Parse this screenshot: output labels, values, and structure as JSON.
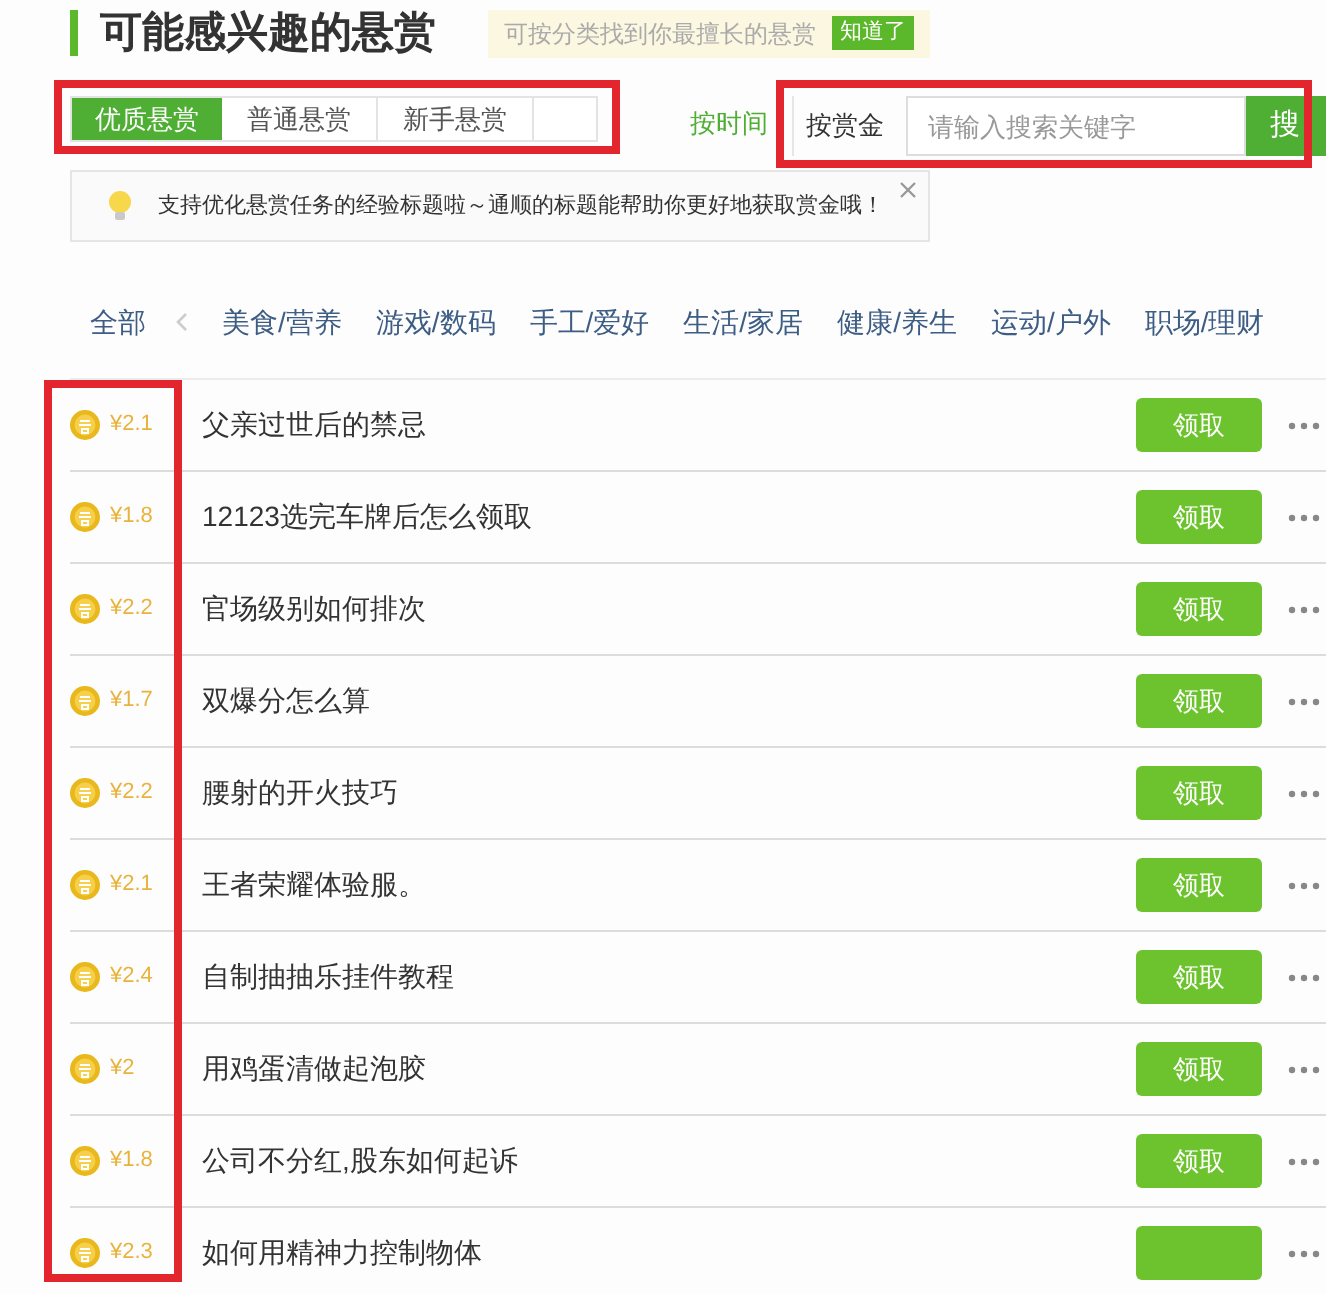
{
  "header": {
    "title": "可能感兴趣的悬赏",
    "hint": "可按分类找到你最擅长的悬赏",
    "hint_button": "知道了"
  },
  "tab_bar": {
    "annotated": true,
    "tabs": [
      {
        "label": "优质悬赏",
        "selected": true
      },
      {
        "label": "普通悬赏",
        "selected": false
      },
      {
        "label": "新手悬赏",
        "selected": false
      }
    ]
  },
  "sort": {
    "label": "按时间"
  },
  "search": {
    "annotated": true,
    "label": "按赏金",
    "placeholder": "请输入搜索关键字",
    "button": "搜"
  },
  "tip": {
    "text": "支持优化悬赏任务的经验标题啦～通顺的标题能帮助你更好地获取赏金哦！"
  },
  "categories": [
    "全部",
    "美食/营养",
    "游戏/数码",
    "手工/爱好",
    "生活/家居",
    "健康/养生",
    "运动/户外",
    "职场/理财"
  ],
  "reward_list": {
    "annotated": true,
    "rows": [
      {
        "reward": "¥2.1",
        "title": "父亲过世后的禁忌",
        "action": "领取"
      },
      {
        "reward": "¥1.8",
        "title": "12123选完车牌后怎么领取",
        "action": "领取"
      },
      {
        "reward": "¥2.2",
        "title": "官场级别如何排次",
        "action": "领取"
      },
      {
        "reward": "¥1.7",
        "title": "双爆分怎么算",
        "action": "领取"
      },
      {
        "reward": "¥2.2",
        "title": "腰射的开火技巧",
        "action": "领取"
      },
      {
        "reward": "¥2.1",
        "title": "王者荣耀体验服。",
        "action": "领取"
      },
      {
        "reward": "¥2.4",
        "title": "自制抽抽乐挂件教程",
        "action": "领取"
      },
      {
        "reward": "¥2",
        "title": "用鸡蛋清做起泡胶",
        "action": "领取"
      },
      {
        "reward": "¥1.8",
        "title": "公司不分红,股东如何起诉",
        "action": "领取"
      },
      {
        "reward": "¥2.3",
        "title": "如何用精神力控制物体"
      }
    ]
  }
}
